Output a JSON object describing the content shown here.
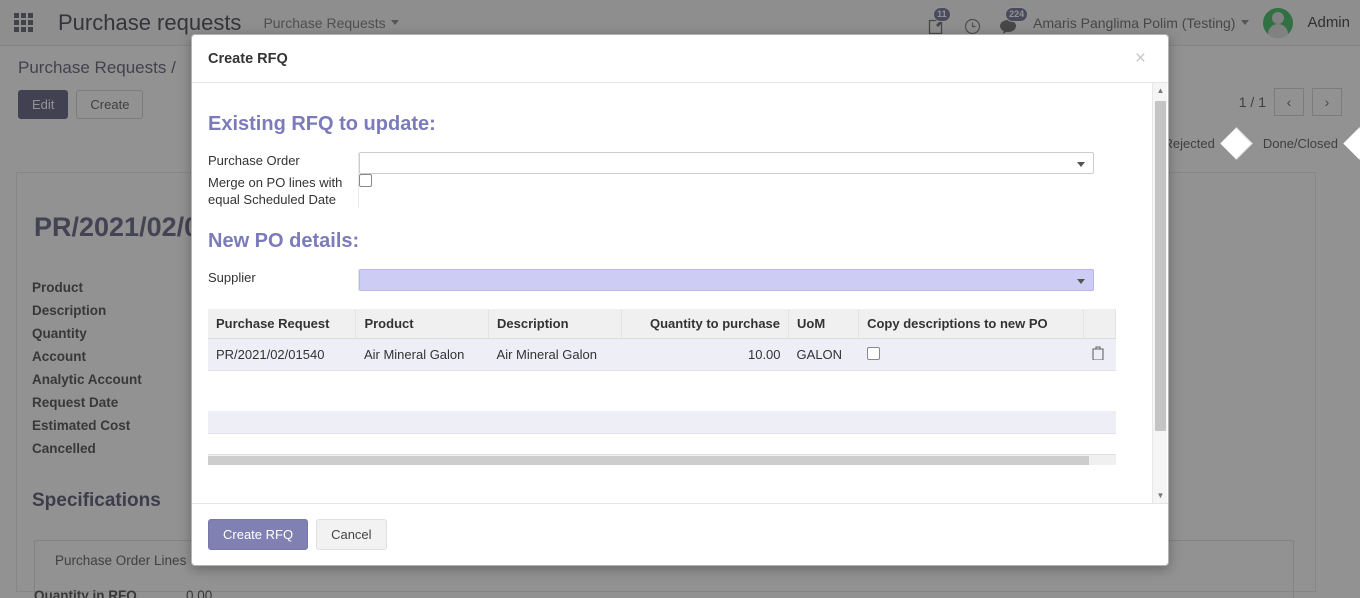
{
  "topbar": {
    "apps_icon": "apps-grid-icon",
    "app_title": "Purchase requests",
    "menu_label": "Purchase Requests",
    "activity_badge": "11",
    "messages_badge": "224",
    "edit_icon": "edit-document-icon",
    "clock_icon": "clock-icon",
    "chat_icon": "chat-bubble-icon",
    "user_name": "Amaris Panglima Polim (Testing)",
    "admin_label": "Admin"
  },
  "background": {
    "breadcrumb": "Purchase Requests /",
    "edit_label": "Edit",
    "create_label": "Create",
    "pager_text": "1 / 1",
    "pager_prev": "‹",
    "pager_next": "›",
    "status_steps": [
      "Rejected",
      "Done/Closed"
    ],
    "record_title": "PR/2021/02/0",
    "field_labels": [
      "Product",
      "Description",
      "Quantity",
      "Account",
      "Analytic Account",
      "Request Date",
      "Estimated Cost",
      "Cancelled"
    ],
    "specifications_title": "Specifications",
    "tab_label": "Purchase Order Lines",
    "qty_in_rfq_label": "Quantity in RFQ",
    "qty_in_rfq_value": "0.00"
  },
  "modal": {
    "title": "Create RFQ",
    "close_label": "×",
    "section_existing": "Existing RFQ to update:",
    "section_new": "New PO details:",
    "purchase_order_label": "Purchase Order",
    "purchase_order_value": "",
    "merge_label": "Merge on PO lines with equal Scheduled Date",
    "merge_checked": false,
    "supplier_label": "Supplier",
    "supplier_value": "",
    "supplier_highlight_color": "#ccccf5",
    "table": {
      "columns": [
        "Purchase Request",
        "Product",
        "Description",
        "Quantity to purchase",
        "UoM",
        "Copy descriptions to new PO"
      ],
      "rows": [
        {
          "purchase_request": "PR/2021/02/01540",
          "product": "Air Mineral Galon",
          "description": "Air Mineral Galon",
          "quantity": "10.00",
          "uom": "GALON",
          "copy_description": false,
          "delete_icon": "trash-icon"
        }
      ]
    },
    "footer": {
      "submit_label": "Create RFQ",
      "cancel_label": "Cancel",
      "submit_color": "#8080b3"
    }
  }
}
